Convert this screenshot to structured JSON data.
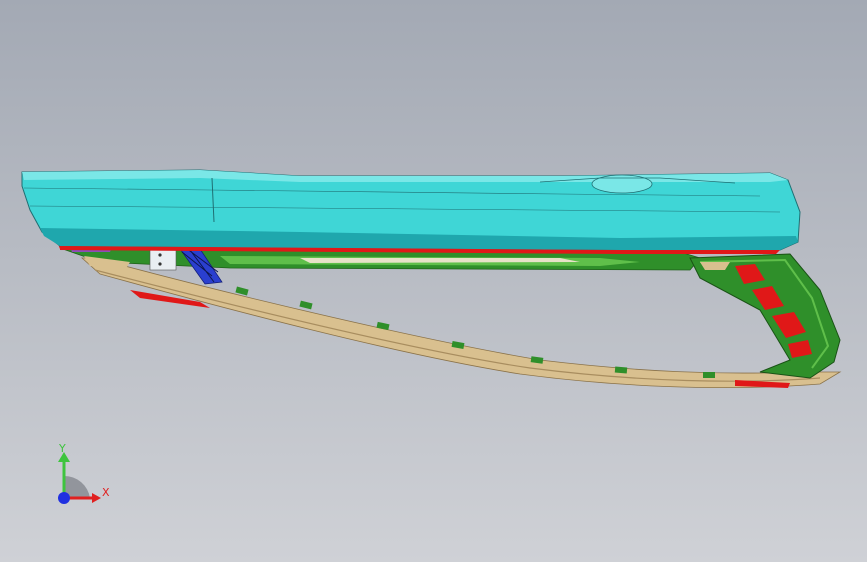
{
  "triad": {
    "y_label": "Y",
    "x_label": "X",
    "colors": {
      "y": "#3ec43e",
      "x": "#e02020",
      "z": "#2030e0"
    }
  },
  "model": {
    "colors": {
      "shell": "#3fd6d6",
      "shell_dark": "#1fa7ad",
      "shell_light": "#7ae7e7",
      "bracket": "#2f8f2a",
      "bracket_light": "#5fbf4a",
      "rail": "#d9c08f",
      "rail_dark": "#a88d5f",
      "accent": "#e01818",
      "clip": "#2a3fcf",
      "purple": "#8a4fb8"
    }
  }
}
